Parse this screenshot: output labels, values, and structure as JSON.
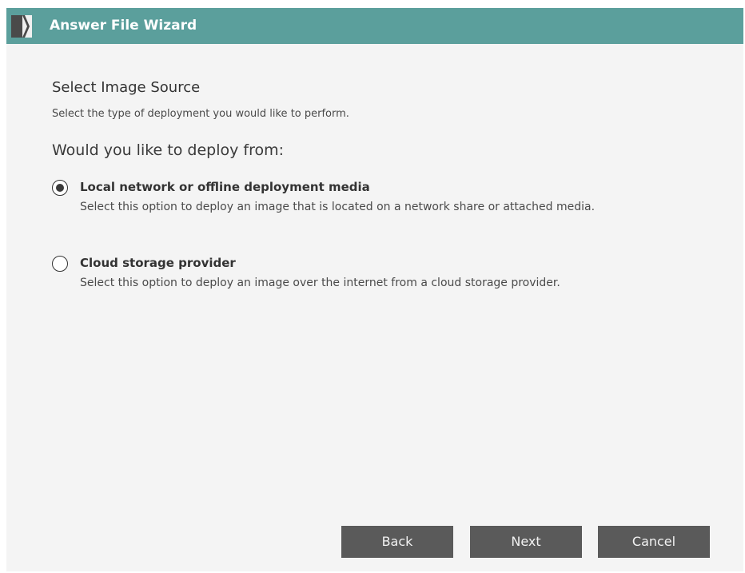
{
  "window": {
    "title": "Answer File Wizard"
  },
  "page": {
    "heading": "Select Image Source",
    "subheading": "Select the type of deployment you would like to perform.",
    "question": "Would you like to deploy from:"
  },
  "options": [
    {
      "title": "Local network or offline deployment media",
      "description": "Select this option to deploy an image that is located on a network share or attached media.",
      "selected": true
    },
    {
      "title": "Cloud storage provider",
      "description": "Select this option to deploy an image over the internet from a cloud storage provider.",
      "selected": false
    }
  ],
  "buttons": {
    "back": "Back",
    "next": "Next",
    "cancel": "Cancel"
  },
  "colors": {
    "titlebar": "#5b9f9c",
    "button": "#5a5a5a",
    "background": "#f4f4f4"
  }
}
